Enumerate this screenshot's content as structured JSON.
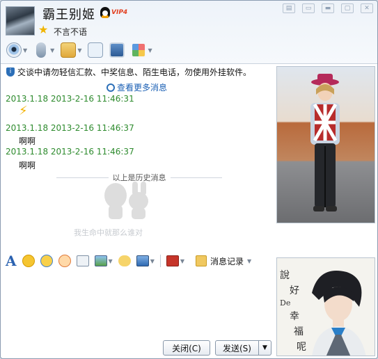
{
  "header": {
    "nickname": "霸王别姬",
    "vip_label": "VIP4",
    "signature": "不言不语"
  },
  "window_buttons": [
    "skin-button",
    "sidebar-button",
    "minimize-button",
    "maximize-button",
    "close-window-button"
  ],
  "chat": {
    "security_notice": "交谈中请勿轻信汇款、中奖信息、陌生电话，勿使用外挂软件。",
    "more_messages_label": "查看更多消息",
    "messages": [
      {
        "header": "2013.1.18 2013-2-16 11:46:31",
        "body": "⚡"
      },
      {
        "header": "2013.1.18 2013-2-16 11:46:37",
        "body": "啊啊"
      },
      {
        "header": "2013.1.18 2013-2-16 11:46:37",
        "body": "啊啊"
      }
    ],
    "history_divider": "以上是历史消息",
    "watermark_text": "我生命中就那么谁对"
  },
  "input_toolbar": {
    "message_record_label": "消息记录"
  },
  "footer": {
    "close_label": "关闭(C)",
    "send_label": "发送(S)"
  },
  "photo2_text": [
    "說",
    "好",
    "De",
    "幸",
    "福",
    "呢"
  ],
  "colors": {
    "accent": "#1a5fb4",
    "timestamp": "#2e8b2e",
    "vip": "#e24020"
  }
}
